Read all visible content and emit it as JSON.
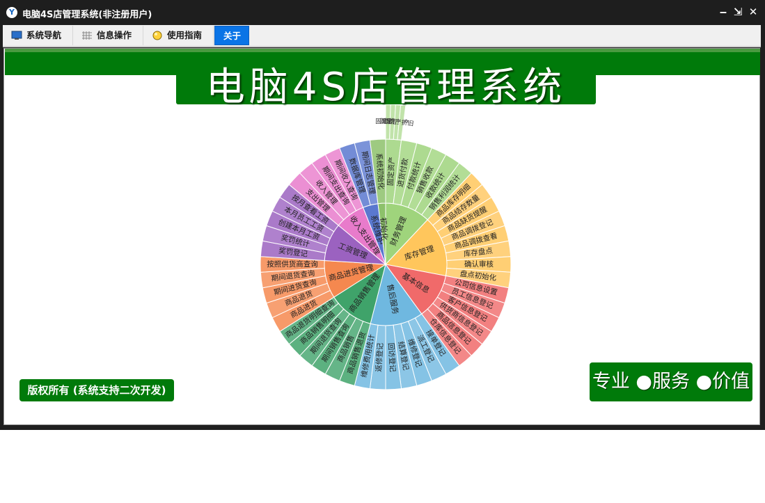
{
  "window": {
    "title": "电脑4S店管理系统(非注册用户)",
    "app_icon": "app-logo-icon",
    "controls": [
      "minimize-icon",
      "restore-icon",
      "close-icon"
    ]
  },
  "tabs": [
    {
      "label": "系统导航",
      "icon": "monitor-icon",
      "active": false
    },
    {
      "label": "信息操作",
      "icon": "grid-icon",
      "active": false
    },
    {
      "label": "使用指南",
      "icon": "lightbulb-icon",
      "active": false
    },
    {
      "label": "关于",
      "icon": "",
      "active": true
    }
  ],
  "banner": {
    "title": "电脑4S店管理系统"
  },
  "copyright": "版权所有 (系统支持二次开发)",
  "slogan": "专业 ●服务 ●价值",
  "colors": {
    "accent_green": "#007a0a",
    "tab_active": "#0a74e6"
  },
  "sunburst": {
    "center": "初始化",
    "segments": [
      {
        "name": "财务管理",
        "color": "#9fd47c",
        "children": [
          "固定资产",
          "进货付款",
          "付款统计",
          "销售收款",
          "收款统计",
          "销售利润统计"
        ],
        "grandchildren": [
          "固定资产",
          "固定资产",
          "固定资产",
          "资产折旧"
        ]
      },
      {
        "name": "库存管理",
        "color": "#ffc65c",
        "children": [
          "商品库存明细",
          "商品结存数量",
          "商品缺货提醒",
          "商品调拨登记",
          "商品调拨查看",
          "库存盘点",
          "确认审核",
          "盘点初始化"
        ]
      },
      {
        "name": "基本信息",
        "color": "#f06a6a",
        "children": [
          "公司信息设置",
          "员工信息登记",
          "客户信息登记",
          "供货商信息登记",
          "商品信息登记",
          "仓库信息登记"
        ]
      },
      {
        "name": "售后服务",
        "color": "#6fb8e0",
        "children": [
          "接单登记",
          "派工登记",
          "维修登记",
          "结算登记",
          "回访登记",
          "返修登记",
          "维修费用统计"
        ]
      },
      {
        "name": "商品销售管理",
        "color": "#3fa36a",
        "children": [
          "商品销售退货",
          "商品销售",
          "期间销售查询",
          "期间退货查询",
          "商品销售明细",
          "商品退货明细查询"
        ]
      },
      {
        "name": "商品进货管理",
        "color": "#f5884f",
        "children": [
          "商品进货",
          "商品退货",
          "期间进货查询",
          "期间退货查询",
          "按照供货商查询"
        ]
      },
      {
        "name": "工资管理",
        "color": "#9b62c0",
        "children": [
          "奖罚登记",
          "奖罚统计",
          "创建本月工资",
          "本月员工工资",
          "按月查看工资"
        ]
      },
      {
        "name": "收入支出管理",
        "color": "#e87bcb",
        "children": [
          "支出管理",
          "收入管理",
          "期间支出查询",
          "期间收入查询"
        ]
      },
      {
        "name": "系统维护",
        "color": "#5a78cf",
        "children": [
          "数据库管理",
          "期间日志管理"
        ]
      },
      {
        "name": "初始化",
        "color": "#8dc16b",
        "children": [
          "系统初始化"
        ]
      }
    ]
  }
}
